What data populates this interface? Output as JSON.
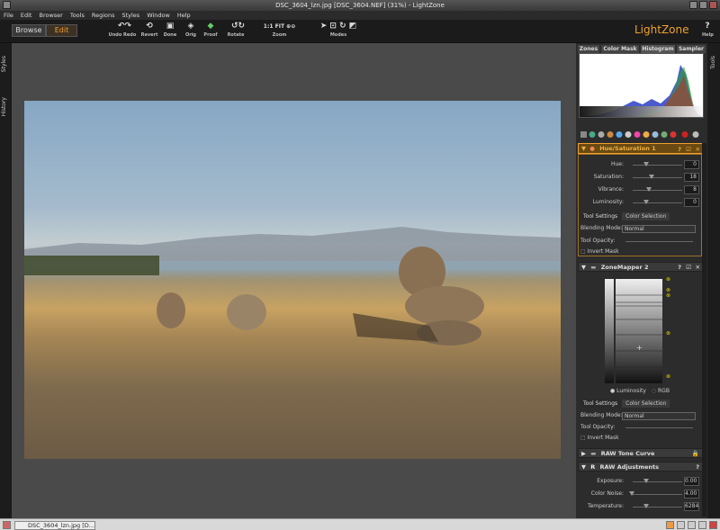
{
  "window": {
    "title": "DSC_3604_lzn.jpg [DSC_3604.NEF] (31%) - LightZone"
  },
  "menu": [
    "File",
    "Edit",
    "Browser",
    "Tools",
    "Regions",
    "Styles",
    "Window",
    "Help"
  ],
  "toolbar": {
    "browse": "Browse",
    "edit": "Edit",
    "undo_redo": "Undo Redo",
    "revert": "Revert",
    "done": "Done",
    "orig": "Orig",
    "proof": "Proof",
    "rotate": "Rotate",
    "zoom": "Zoom",
    "zoom_11": "1:1",
    "zoom_fit": "FIT",
    "modes": "Modes",
    "logo": "LightZone",
    "help": "Help"
  },
  "left_tabs": [
    "Styles",
    "History"
  ],
  "right_tabs": [
    "Tools"
  ],
  "panel": {
    "tabs": [
      "Zones",
      "Color Mask",
      "Histogram",
      "Sampler"
    ],
    "hue_sat": {
      "title": "Hue/Saturation 1",
      "rows": [
        {
          "label": "Hue:",
          "value": "0",
          "level": 0.5
        },
        {
          "label": "Saturation:",
          "value": "18",
          "level": 0.6
        },
        {
          "label": "Vibrance:",
          "value": "8",
          "level": 0.55
        },
        {
          "label": "Luminosity:",
          "value": "0",
          "level": 0.5
        }
      ],
      "sub_tabs": [
        "Tool Settings",
        "Color Selection"
      ],
      "blending_label": "Blending Mode:",
      "blending_value": "Normal",
      "opacity_label": "Tool Opacity:",
      "invert": "Invert Mask"
    },
    "zonemapper": {
      "title": "ZoneMapper 2",
      "luminosity": "Luminosity",
      "rgb": "RGB",
      "sub_tabs": [
        "Tool Settings",
        "Color Selection"
      ],
      "blending_label": "Blending Mode:",
      "blending_value": "Normal",
      "opacity_label": "Tool Opacity:",
      "invert": "Invert Mask"
    },
    "tone_curve": {
      "title": "RAW Tone Curve"
    },
    "raw_adj": {
      "title": "RAW Adjustments",
      "rows": [
        {
          "label": "Exposure:",
          "value": "0.00",
          "level": 0.5
        },
        {
          "label": "Color Noise:",
          "value": "4.00",
          "level": 0.25
        },
        {
          "label": "Temperature:",
          "value": "6284",
          "level": 0.5
        }
      ]
    }
  },
  "taskbar": {
    "item": "DSC_3604_lzn.jpg [D..."
  }
}
